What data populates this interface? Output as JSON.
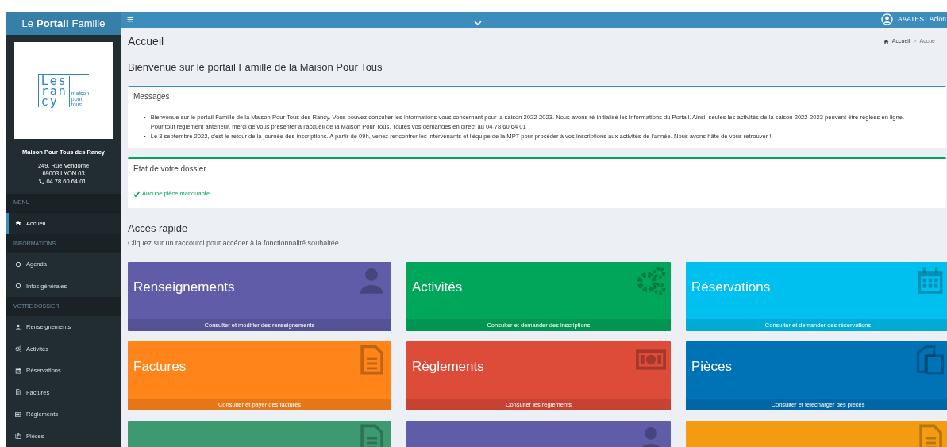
{
  "brand": {
    "parts": [
      {
        "text": "Le",
        "bold": false
      },
      {
        "text": "Portail",
        "bold": true
      },
      {
        "text": "Famille",
        "bold": false
      }
    ]
  },
  "header": {
    "menu_toggle": "≡",
    "user": "AAATEST Acion"
  },
  "sidebar": {
    "logo": {
      "letters": [
        "Les",
        "ran",
        "cy"
      ],
      "tagline": [
        "maison",
        "pour",
        "tous"
      ]
    },
    "org": {
      "name": "Maison Pour Tous des Rancy",
      "address": [
        "249, Rue Vendome",
        "69003 LYON 03"
      ],
      "phone": "04.78.60.64.01."
    },
    "sections": [
      {
        "header": "MENU",
        "items": [
          {
            "label": "Accueil",
            "kind": "home",
            "selected": true
          }
        ]
      },
      {
        "header": "INFORMATIONS",
        "items": [
          {
            "label": "Agenda",
            "kind": "circle",
            "selected": false
          },
          {
            "label": "Infos générales",
            "kind": "circle",
            "selected": false
          }
        ]
      },
      {
        "header": "VOTRE DOSSIER",
        "items": [
          {
            "label": "Renseignements",
            "kind": "user",
            "selected": false
          },
          {
            "label": "Activités",
            "kind": "gears",
            "selected": false
          },
          {
            "label": "Réservations",
            "kind": "calendar",
            "selected": false
          },
          {
            "label": "Factures",
            "kind": "file",
            "selected": false
          },
          {
            "label": "Règlements",
            "kind": "money",
            "selected": false
          },
          {
            "label": "Pièces",
            "kind": "copy",
            "selected": false
          }
        ]
      }
    ]
  },
  "page": {
    "title": "Accueil",
    "breadcrumb": {
      "items": [
        "Accueil",
        "Accue"
      ],
      "separator": ">"
    },
    "welcome": "Bienvenue sur le portail Famille de la Maison Pour Tous"
  },
  "messages": {
    "title": "Messages",
    "bullet": "•",
    "items": [
      "Bienvenue sur le portail Famille de la Maison Pour Tous des Rancy. Vous pouvez consulter les informations vous concernant pour la saison 2022-2023. Nous avons ré-initialisé les informations du Portail. Ainsi, seules les activités de la saison 2022-2023 peuvent être réglées en ligne. Pour tout règlement antérieur, merci de vous présenter à l'accueil de la Maison Pour Tous. Toutes vos demandes en direct au 04 78 60 64 01",
      "Le 3 septembre 2022, c'est le retour de la journée des inscriptions. A partir de 09h, venez rencontrer les intervenants et l'équipe de la MPT pour procéder à vos inscriptions aux activités de l'année. Nous avons hâte de vous retrouver !"
    ]
  },
  "dossier": {
    "title": "Etat de votre dossier",
    "status": "Aucune pièce manquante"
  },
  "quick_access": {
    "title": "Accès rapide",
    "subtitle": "Cliquez sur un raccourci pour accéder à la fonctionnalité souhaitée",
    "tiles": [
      {
        "title": "Renseignements",
        "subtitle": "Consulter et modifier des renseignements",
        "kind": "user",
        "color": "#605ca8"
      },
      {
        "title": "Activités",
        "subtitle": "Consulter et demander des inscriptions",
        "kind": "gears",
        "color": "#00a65a"
      },
      {
        "title": "Réservations",
        "subtitle": "Consulter et demander des réservations",
        "kind": "calendar",
        "color": "#00c0ef"
      },
      {
        "title": "Factures",
        "subtitle": "Consulter et payer des factures",
        "kind": "file",
        "color": "#ff851b"
      },
      {
        "title": "Règlements",
        "subtitle": "Consulter les règlements",
        "kind": "money",
        "color": "#dd4b39"
      },
      {
        "title": "Pièces",
        "subtitle": "Consulter et télécharger des pièces",
        "kind": "copy",
        "color": "#0073b7"
      },
      {
        "kind": "file",
        "color": "#3d9970"
      },
      {
        "kind": "user",
        "color": "#605ca8"
      },
      {
        "kind": "file",
        "color": "#f39c12"
      }
    ]
  }
}
